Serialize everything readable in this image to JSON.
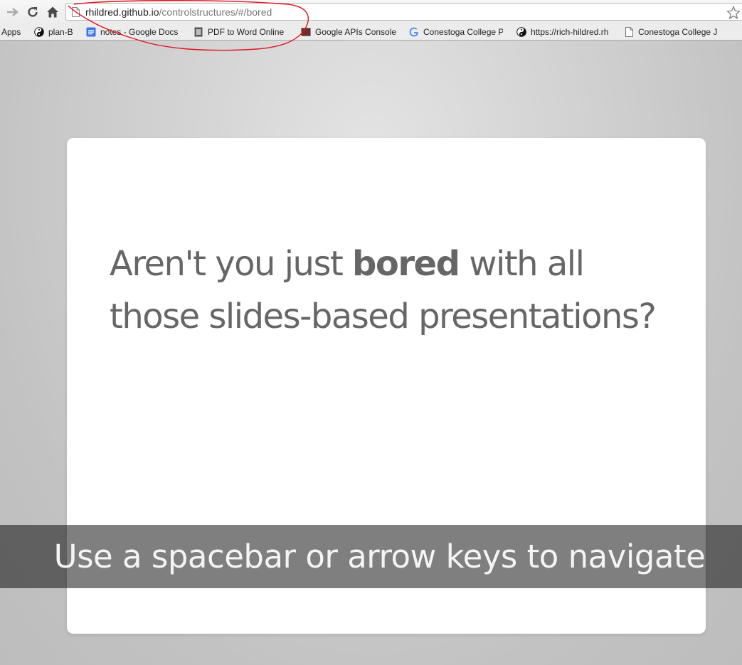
{
  "browser": {
    "url_host": "rhildred.github.io",
    "url_path": "/controlstructures/#/bored"
  },
  "bookmarks": [
    {
      "label": "Apps",
      "icon": "apps-icon"
    },
    {
      "label": "plan-B",
      "icon": "yin-yang-icon"
    },
    {
      "label": "notes - Google Docs",
      "icon": "google-docs-icon"
    },
    {
      "label": "PDF to Word Online",
      "icon": "pdf-icon"
    },
    {
      "label": "Google APIs Console",
      "icon": "console-icon"
    },
    {
      "label": "Conestoga College P",
      "icon": "google-icon"
    },
    {
      "label": "https://rich-hildred.rh",
      "icon": "yin-yang-icon"
    },
    {
      "label": "Conestoga College J",
      "icon": "page-icon"
    }
  ],
  "slide": {
    "line1_pre": "Aren't you just ",
    "line1_bold": "bored",
    "line1_post": " with all",
    "line2": "those slides-based presentations?"
  },
  "hint": "Use a spacebar or arrow keys to navigate",
  "colors": {
    "annotation": "#e0141e",
    "slide_text": "#666666",
    "background": "#d4d4d4"
  }
}
